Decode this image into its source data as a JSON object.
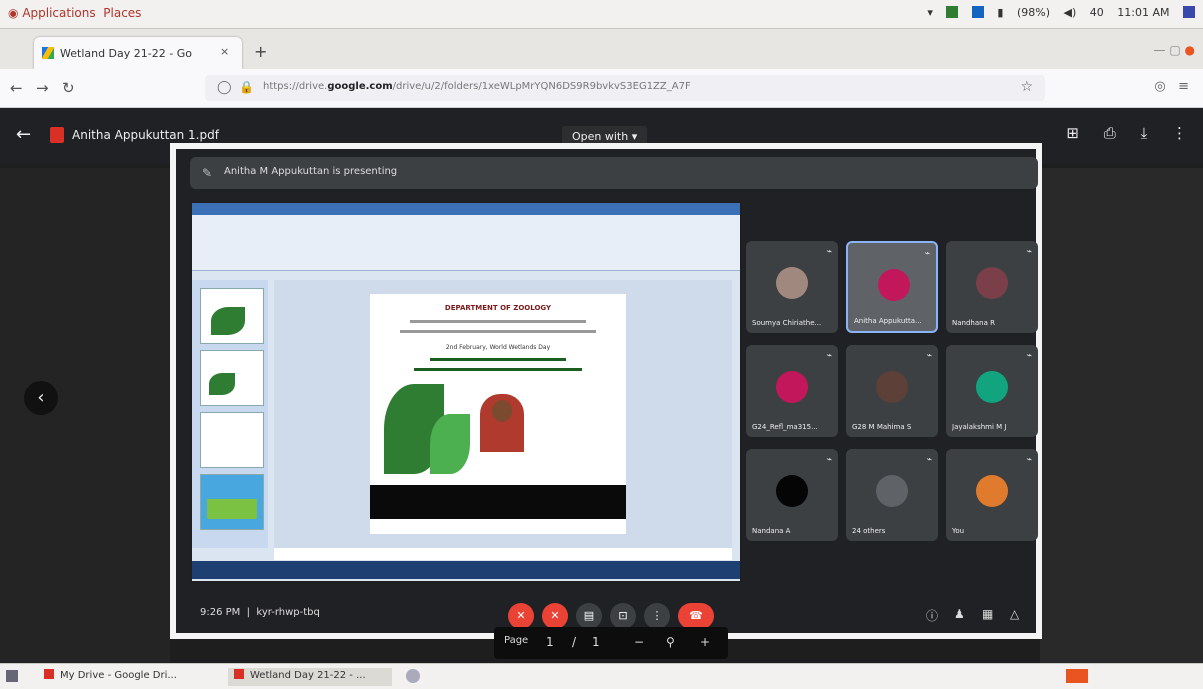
{
  "topbar": {
    "app_menu": "Applications",
    "places_menu": "Places",
    "battery": "(98%)",
    "volume": "40",
    "time": "11:01 AM"
  },
  "browser": {
    "tab_title": "Wetland Day 21-22 - Go",
    "tab_close": "×",
    "new_tab": "+",
    "url_prefix": "https://drive.",
    "url_domain": "google.com",
    "url_rest": "/drive/u/2/folders/1xeWLpMrYQN6DS9R9bvkvS3EG1ZZ_A7F"
  },
  "drive": {
    "file_name": "Anitha Appukuttan 1.pdf",
    "open_with": "Open with ▾"
  },
  "meet": {
    "presenting_text": "Anitha M Appukuttan is presenting",
    "meeting_time": "9:26 PM",
    "meeting_code": "kyr-rhwp-tbq",
    "slide": {
      "header": "DEPARTMENT OF ZOOLOGY",
      "date_line": "2nd February, World Wetlands Day"
    },
    "participants": [
      {
        "name": "Soumya Chiriathe...",
        "color": "#a1887f"
      },
      {
        "name": "Anitha Appukutta...",
        "color": "#c2185b"
      },
      {
        "name": "Nandhana R",
        "color": "#7b3f4a"
      },
      {
        "name": "G24_Refl_ma315...",
        "color": "#c2185b"
      },
      {
        "name": "G28 M Mahima S",
        "color": "#5d4037"
      },
      {
        "name": "Jayalakshmi M J",
        "color": "#12a37f"
      },
      {
        "name": "Nandana A",
        "color": "#050505"
      },
      {
        "name": "24 others",
        "color": "#5f6368"
      },
      {
        "name": "You",
        "color": "#e07b2d"
      }
    ]
  },
  "zoom": {
    "page_label": "Page",
    "page_num": "1",
    "page_sep": "/",
    "page_total": "1",
    "minus": "−",
    "zoom_icon": "⚲",
    "plus": "+"
  },
  "taskbar": {
    "item1": "My Drive - Google Dri...",
    "item2": "Wetland Day 21-22 - ..."
  }
}
